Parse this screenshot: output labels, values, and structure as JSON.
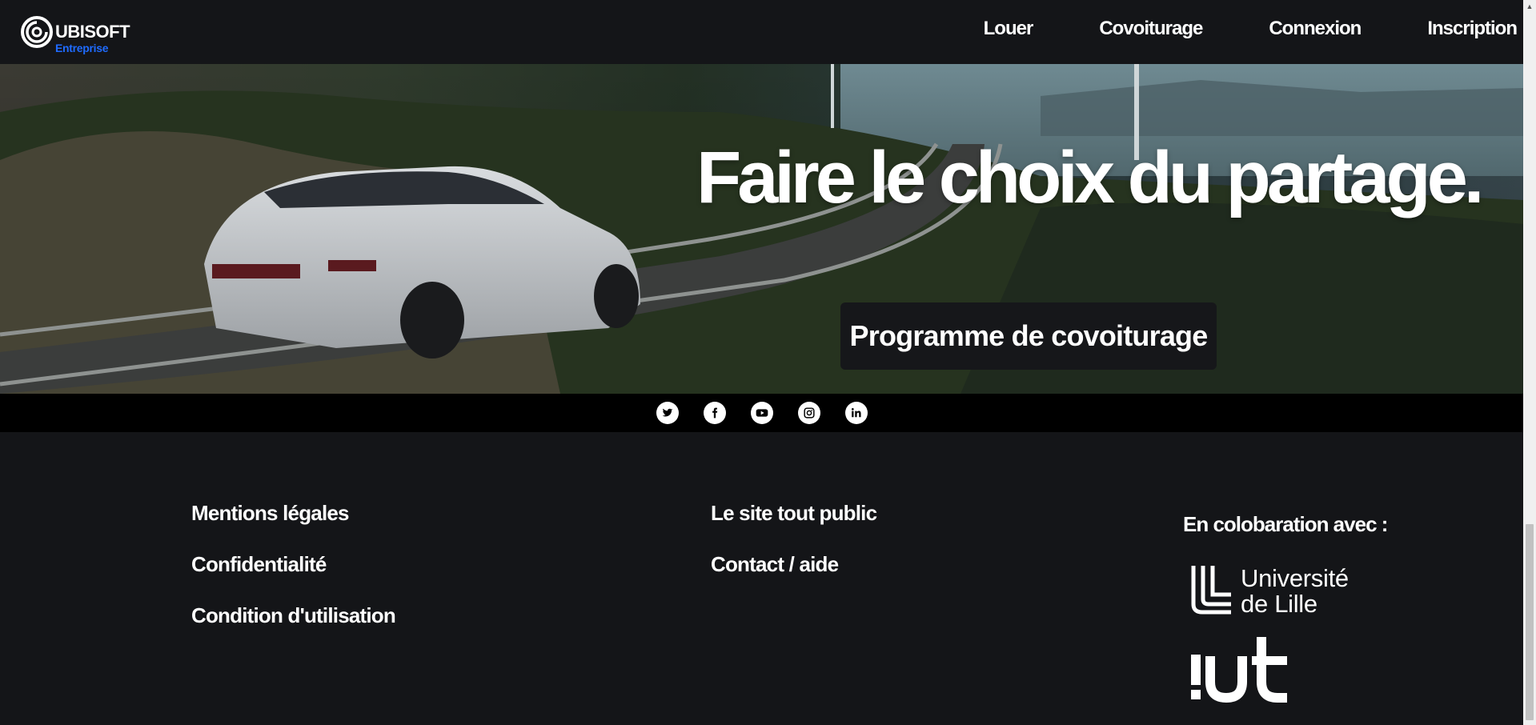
{
  "header": {
    "brand": "UBISOFT",
    "brand_sub": "Entreprise",
    "nav": [
      "Louer",
      "Covoiturage",
      "Connexion",
      "Inscription"
    ]
  },
  "hero": {
    "title": "Faire le choix du partage.",
    "cta": "Programme de covoiturage"
  },
  "social": {
    "icons": [
      "twitter-icon",
      "facebook-icon",
      "youtube-icon",
      "instagram-icon",
      "linkedin-icon"
    ]
  },
  "footer": {
    "col1": [
      "Mentions légales",
      "Confidentialité",
      "Condition d'utilisation"
    ],
    "col2": [
      "Le site tout public",
      "Contact / aide"
    ],
    "collab_title": "En colobaration avec :",
    "partner1_line1": "Université",
    "partner1_line2": "de Lille",
    "partner2": "iut"
  },
  "colors": {
    "background": "#141518",
    "accent": "#1f6bff",
    "social_bar": "#000000"
  }
}
